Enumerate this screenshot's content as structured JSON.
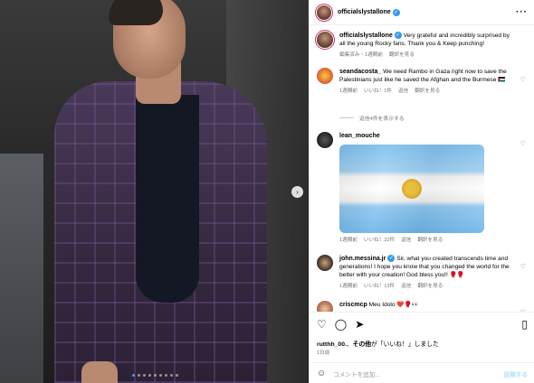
{
  "post": {
    "username": "officialslystallone",
    "caption": "Very grateful and incredibly surprised by all the young Rocky fans. Thank you & Keep punching!",
    "caption_meta": [
      "編集済み・1週間前",
      "翻訳を見る"
    ]
  },
  "comments": [
    {
      "username": "seandacosta_",
      "text": "We need Rambo in Gaza right now to save the Palestinians just like he saved the Afghan and the Burmese",
      "emoji": "🇵🇸",
      "meta": [
        "1週間前",
        "いいね！1件",
        "返信",
        "翻訳を見る"
      ],
      "replies": "返信4件を表示する"
    },
    {
      "username": "lean_mouche",
      "text": "",
      "meta": [
        "1週間前",
        "いいね！32件",
        "返信",
        "翻訳を見る"
      ]
    },
    {
      "username": "john.messina.jr",
      "text": "Sir, what you created transcends time and generations! I hope you know that you changed the world for the better with your creation! God bless you!!",
      "emoji": "🥊🥊",
      "meta": [
        "1週間前",
        "いいね！13件",
        "返信",
        "翻訳を見る"
      ]
    },
    {
      "username": "criscmcp",
      "text": "Meu Idolo",
      "emoji": "❤️🥊👀"
    }
  ],
  "likes": {
    "user": "rutthh_00.",
    "suffix": "その他",
    "text": "が「いいね！」しました"
  },
  "date": "1日前",
  "add_comment_placeholder": "コメントを追加...",
  "post_button": "投稿する",
  "carousel": {
    "slides": 9,
    "active": 0
  },
  "icons": {
    "more": "more-icon",
    "heart": "heart-icon",
    "comment": "comment-icon",
    "share": "share-icon",
    "bookmark": "bookmark-icon",
    "emoji": "emoji-icon",
    "next": "chevron-right-icon"
  },
  "colors": {
    "accent": "#3797f0",
    "muted": "#737373"
  }
}
